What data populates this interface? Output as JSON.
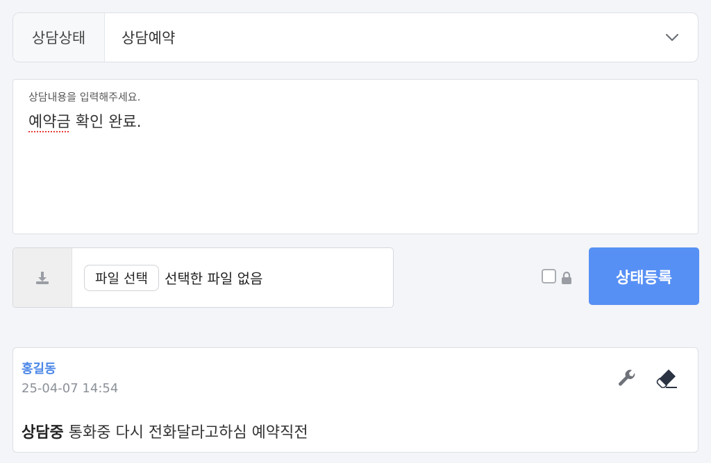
{
  "status": {
    "label": "상담상태",
    "selected": "상담예약",
    "chevron_icon": "chevron-down-icon"
  },
  "memo": {
    "placeholder": "상담내용을 입력해주세요.",
    "value_first_word": "예약금",
    "value_rest": " 확인 완료."
  },
  "file": {
    "icon": "download-icon",
    "button_label": "파일 선택",
    "no_file_text": "선택한 파일 없음"
  },
  "secret": {
    "checked": false,
    "icon": "lock-icon"
  },
  "submit_label": "상태등록",
  "colors": {
    "accent": "#5790f5",
    "author": "#4a86e8"
  },
  "history": [
    {
      "author": "홍길동",
      "datetime": "25-04-07 14:54",
      "status": "상담중",
      "content": "통화중 다시 전화달라고하심 예약직전",
      "actions": [
        "wrench-icon",
        "eraser-icon"
      ]
    }
  ]
}
